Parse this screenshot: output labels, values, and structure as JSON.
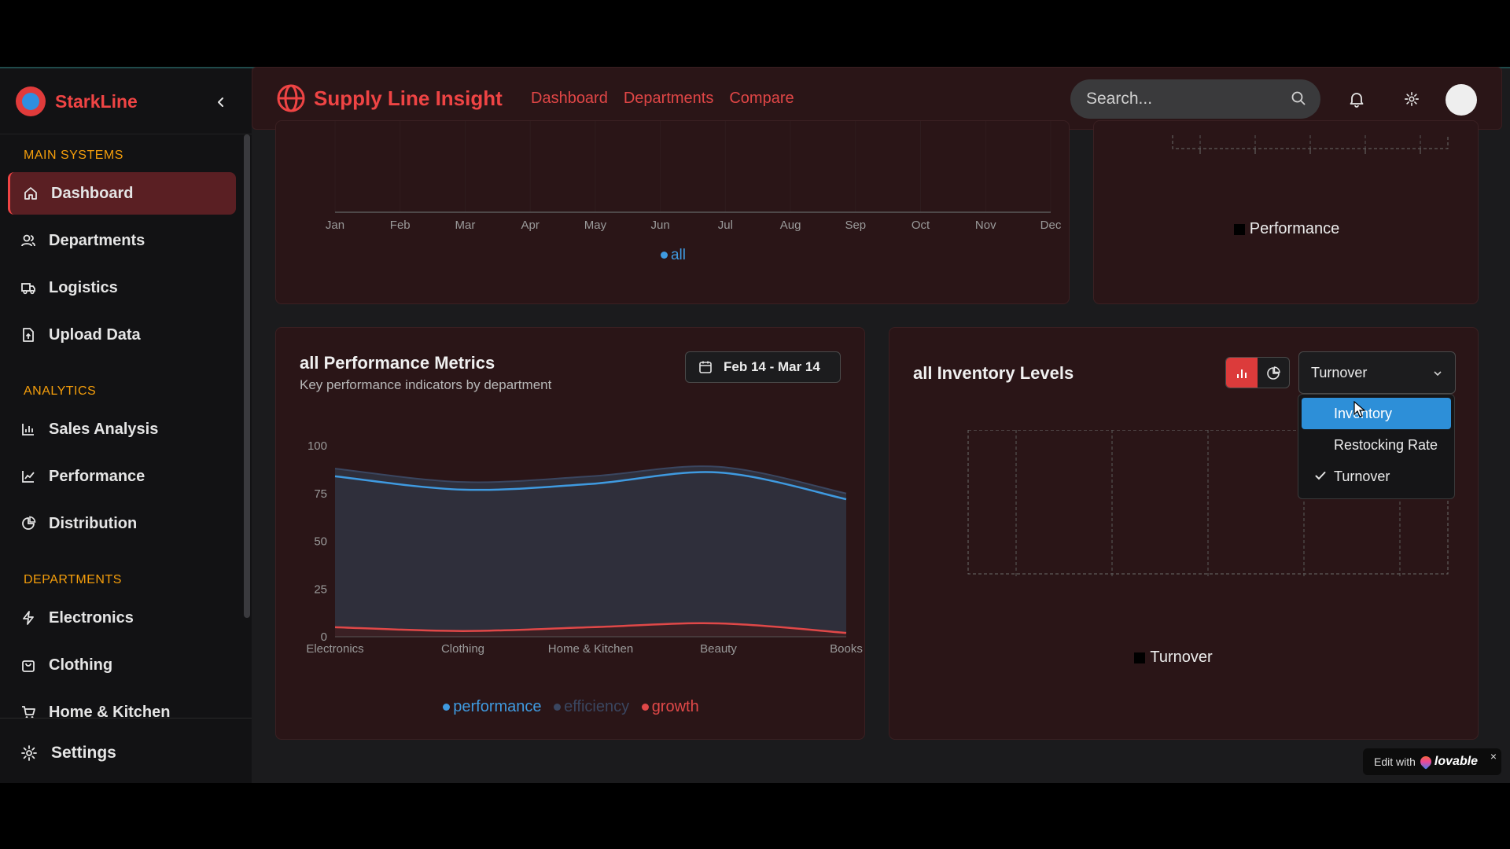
{
  "sidebar": {
    "brand": "StarkLine",
    "sections": {
      "main": "MAIN SYSTEMS",
      "analytics": "ANALYTICS",
      "departments": "DEPARTMENTS"
    },
    "items": {
      "dashboard": "Dashboard",
      "departments": "Departments",
      "logistics": "Logistics",
      "upload": "Upload Data",
      "sales": "Sales Analysis",
      "performance": "Performance",
      "distribution": "Distribution",
      "electronics": "Electronics",
      "clothing": "Clothing",
      "home_kitchen": "Home & Kitchen"
    },
    "settings": "Settings"
  },
  "header": {
    "title": "Supply Line Insight",
    "nav": [
      "Dashboard",
      "Departments",
      "Compare"
    ],
    "search_placeholder": "Search..."
  },
  "top_left_card": {
    "months": [
      "Jan",
      "Feb",
      "Mar",
      "Apr",
      "May",
      "Jun",
      "Jul",
      "Aug",
      "Sep",
      "Oct",
      "Nov",
      "Dec"
    ],
    "legend": "all"
  },
  "top_right_card": {
    "legend": "Performance"
  },
  "perf_card": {
    "title": "all Performance Metrics",
    "subtitle": "Key performance indicators by department",
    "date_range": "Feb 14 - Mar 14",
    "legend": {
      "performance": "performance",
      "efficiency": "efficiency",
      "growth": "growth"
    }
  },
  "chart_data": {
    "type": "area",
    "categories": [
      "Electronics",
      "Clothing",
      "Home & Kitchen",
      "Beauty",
      "Books"
    ],
    "yticks": [
      "100",
      "75",
      "50",
      "25",
      "0"
    ],
    "ylim": [
      0,
      100
    ],
    "series": [
      {
        "name": "performance",
        "values": [
          84,
          77,
          80,
          86,
          72
        ]
      },
      {
        "name": "efficiency",
        "values": [
          88,
          81,
          84,
          89,
          75
        ]
      },
      {
        "name": "growth",
        "values": [
          5,
          3,
          5,
          7,
          2
        ]
      }
    ],
    "colors": {
      "performance": "#3f9ae0",
      "efficiency": "#3a4660",
      "growth": "#e04848"
    }
  },
  "inv_card": {
    "title": "all Inventory Levels",
    "select_value": "Turnover",
    "legend": "Turnover",
    "options": [
      "Inventory",
      "Restocking Rate",
      "Turnover"
    ],
    "selected_option": "Turnover",
    "highlighted_option": "Inventory"
  },
  "lovable": {
    "prefix": "Edit with",
    "brand": "lovable",
    "close": "×"
  }
}
